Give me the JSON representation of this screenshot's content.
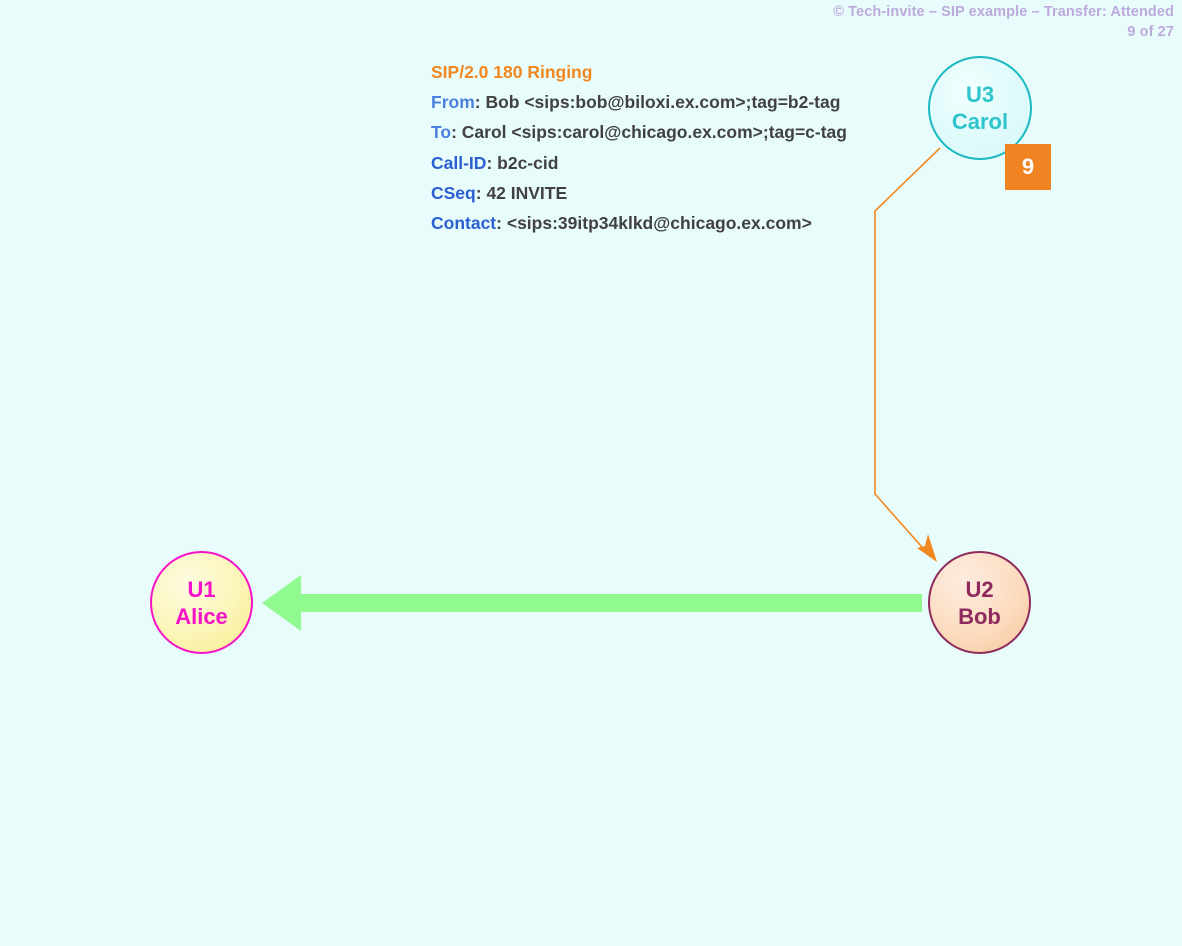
{
  "header": {
    "copyright_line": "© Tech-invite – SIP example – Transfer: Attended",
    "page_indicator": "9 of 27",
    "color": "#bcaadc"
  },
  "sip_message": {
    "start_line": "SIP/2.0 180 Ringing",
    "start_line_color": "#f2871f",
    "headers": [
      {
        "name": "From",
        "separator": ": ",
        "value": "Bob <sips:bob@biloxi.ex.com>;tag=b2-tag"
      },
      {
        "name": "To",
        "separator": ": ",
        "value": "Carol <sips:carol@chicago.ex.com>;tag=c-tag"
      },
      {
        "name": "Call-ID",
        "separator": ": ",
        "value": "b2c-cid"
      },
      {
        "name": "CSeq",
        "separator": ": ",
        "value": "42 INVITE"
      },
      {
        "name": "Contact",
        "separator": ": ",
        "value": "<sips:39itp34klkd@chicago.ex.com>"
      }
    ]
  },
  "step_badge": {
    "number": "9",
    "background": "#f08423",
    "text_color": "#ffffff"
  },
  "nodes": [
    {
      "id": "alice",
      "line1": "U1",
      "line2": "Alice",
      "border_color": "#f612c8",
      "text_color": "#f612c8"
    },
    {
      "id": "bob",
      "line1": "U2",
      "line2": "Bob",
      "border_color": "#8e2a5c",
      "text_color": "#8e2a5c"
    },
    {
      "id": "carol",
      "line1": "U3",
      "line2": "Carol",
      "border_color": "#1ab8c0",
      "text_color": "#2ec4cc"
    }
  ],
  "arrows": {
    "signal_arrow": {
      "from_node": "bob",
      "to_node": "alice",
      "direction": "left",
      "color": "#90fa90"
    },
    "relation_arrow": {
      "from_node": "carol",
      "to_node": "bob",
      "color": "#f2871f",
      "style": "polyline"
    }
  },
  "background_color": "#e9fcfc"
}
